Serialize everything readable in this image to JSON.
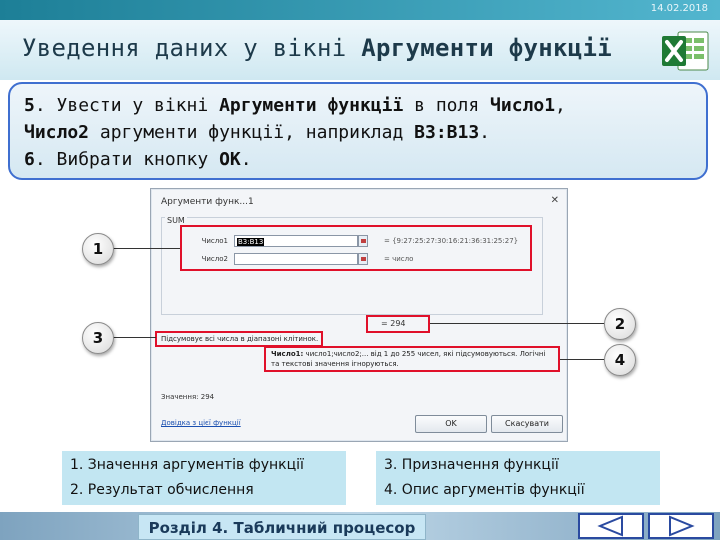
{
  "header": {
    "date": "14.02.2018",
    "title_plain": "Уведення даних у вікні ",
    "title_bold": "Аргументи функції"
  },
  "instructions": {
    "l1_num": "5",
    "l1_a": ". Увести у вікні ",
    "l1_b": "Аргументи функції",
    "l1_c": " в поля ",
    "l1_d": "Число1",
    "l1_e": ",",
    "l2_a": "Число2",
    "l2_b": " аргументи функції, наприклад ",
    "l2_c": "B3:B13",
    "l2_d": ".",
    "l3_num": "6",
    "l3_a": ". Вибрати кнопку ",
    "l3_b": "ОК",
    "l3_c": "."
  },
  "dialog": {
    "title": "Аргументи функ...1",
    "close": "✕",
    "function_name": "SUM",
    "arg1_label": "Число1",
    "arg1_value": "B3:B13",
    "arg1_result": "= {9:27:25:27:30:16:21:36:31:25:27}",
    "arg2_label": "Число2",
    "arg2_result": "= число",
    "equals": "=",
    "total": "= 294",
    "description": "Підсумовує всі числа в діапазоні клітинок.",
    "arg_desc_bold": "Число1:",
    "arg_desc": " число1;число2;... від 1 до 255 чисел, які підсумовуються. Логічні та текстові значення ігноруються.",
    "value_line": "Значення: 294",
    "help_link": "Довідка з цієї функції",
    "ok_label": "OK",
    "cancel_label": "Скасувати"
  },
  "callouts": {
    "c1": "1",
    "c2": "2",
    "c3": "3",
    "c4": "4"
  },
  "legend_left": {
    "item1": "1. Значення аргументів функції",
    "item2": "2. Результат обчислення"
  },
  "legend_right": {
    "item3": "3. Призначення функції",
    "item4": "4. Опис аргументів функції"
  },
  "footer": {
    "section": "Розділ 4. Табличний процесор"
  },
  "icons": {
    "excel": "excel-logo-icon",
    "prev": "nav-prev-triangle-icon",
    "next": "nav-next-triangle-icon"
  },
  "colors": {
    "callout_red": "#e0102a",
    "instr_border": "#3f6fd0",
    "legend_bg": "#c2e6f2",
    "nav_border": "#2a4aa0"
  }
}
